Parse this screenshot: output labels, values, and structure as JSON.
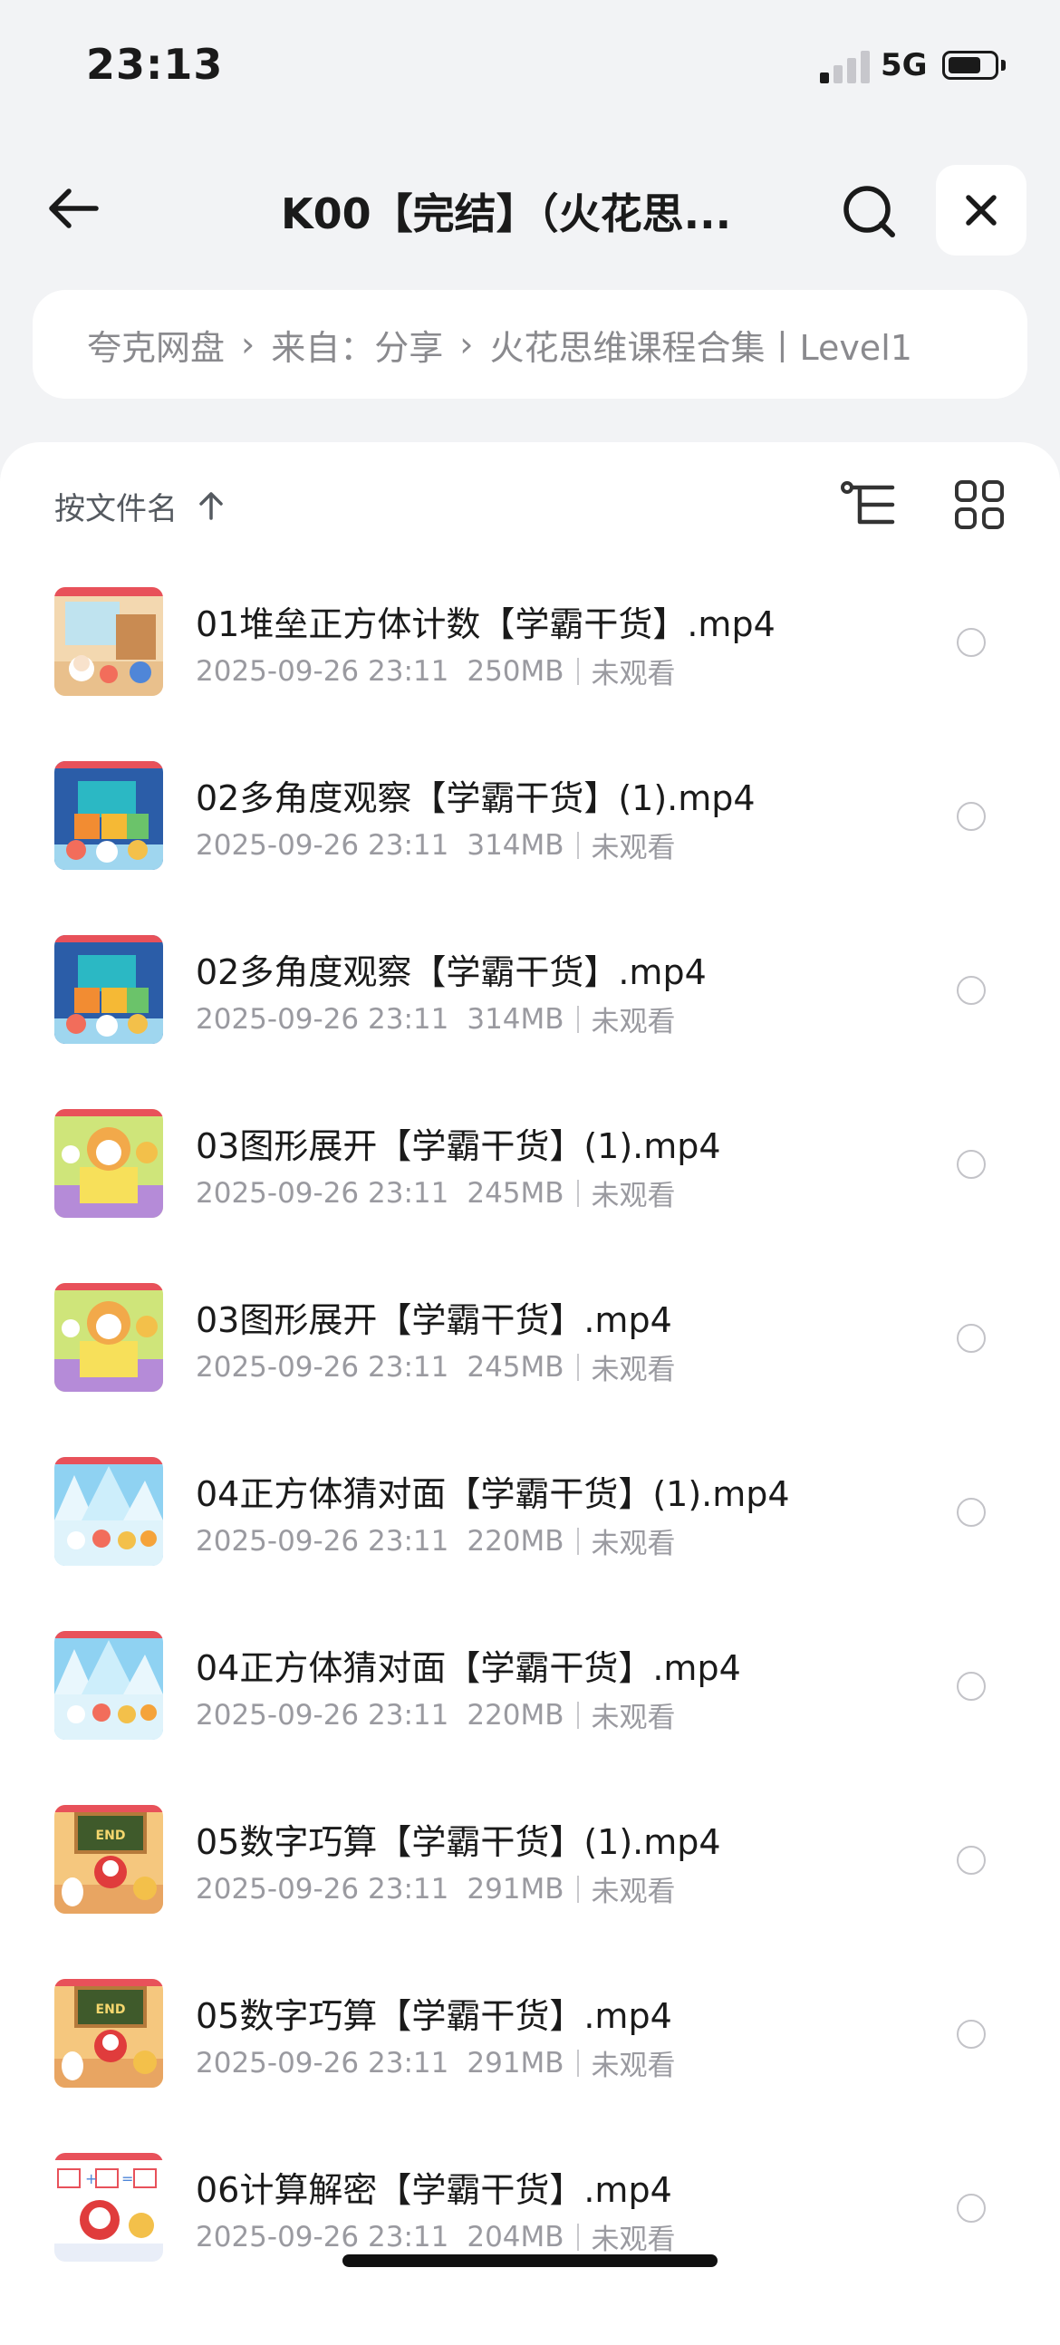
{
  "status_bar": {
    "time": "23:13",
    "network": "5G",
    "signal_bars_on": 1,
    "battery_level": 0.62
  },
  "header": {
    "title": "K00【完结】（火花思..."
  },
  "breadcrumb": [
    {
      "label": "夸克网盘"
    },
    {
      "label": "来自：分享"
    },
    {
      "label": "火花思维课程合集丨Level1"
    }
  ],
  "sort": {
    "label": "按文件名"
  },
  "files": [
    {
      "name": "01堆垒正方体计数【学霸干货】.mp4",
      "date": "2025-09-26 23:11",
      "size": "250MB",
      "status": "未观看",
      "thumb_theme": "room"
    },
    {
      "name": "02多角度观察【学霸干货】(1).mp4",
      "date": "2025-09-26 23:11",
      "size": "314MB",
      "status": "未观看",
      "thumb_theme": "blocks"
    },
    {
      "name": "02多角度观察【学霸干货】.mp4",
      "date": "2025-09-26 23:11",
      "size": "314MB",
      "status": "未观看",
      "thumb_theme": "blocks"
    },
    {
      "name": "03图形展开【学霸干货】(1).mp4",
      "date": "2025-09-26 23:11",
      "size": "245MB",
      "status": "未观看",
      "thumb_theme": "unfold"
    },
    {
      "name": "03图形展开【学霸干货】.mp4",
      "date": "2025-09-26 23:11",
      "size": "245MB",
      "status": "未观看",
      "thumb_theme": "unfold"
    },
    {
      "name": "04正方体猜对面【学霸干货】(1).mp4",
      "date": "2025-09-26 23:11",
      "size": "220MB",
      "status": "未观看",
      "thumb_theme": "ice"
    },
    {
      "name": "04正方体猜对面【学霸干货】.mp4",
      "date": "2025-09-26 23:11",
      "size": "220MB",
      "status": "未观看",
      "thumb_theme": "ice"
    },
    {
      "name": "05数字巧算【学霸干货】(1).mp4",
      "date": "2025-09-26 23:11",
      "size": "291MB",
      "status": "未观看",
      "thumb_theme": "board"
    },
    {
      "name": "05数字巧算【学霸干货】.mp4",
      "date": "2025-09-26 23:11",
      "size": "291MB",
      "status": "未观看",
      "thumb_theme": "board"
    },
    {
      "name": "06计算解密【学霸干货】.mp4",
      "date": "2025-09-26 23:11",
      "size": "204MB",
      "status": "未观看",
      "thumb_theme": "puzzle"
    }
  ],
  "thumb_text": {
    "board": "END"
  },
  "colors": {
    "background": "#f2f3f5",
    "panel": "#ffffff",
    "text": "#1a1a1a",
    "meta": "#9a9aa0"
  },
  "icons": [
    "back-arrow-icon",
    "search-icon",
    "close-icon",
    "tree-view-icon",
    "grid-view-icon",
    "sort-up-arrow-icon"
  ]
}
